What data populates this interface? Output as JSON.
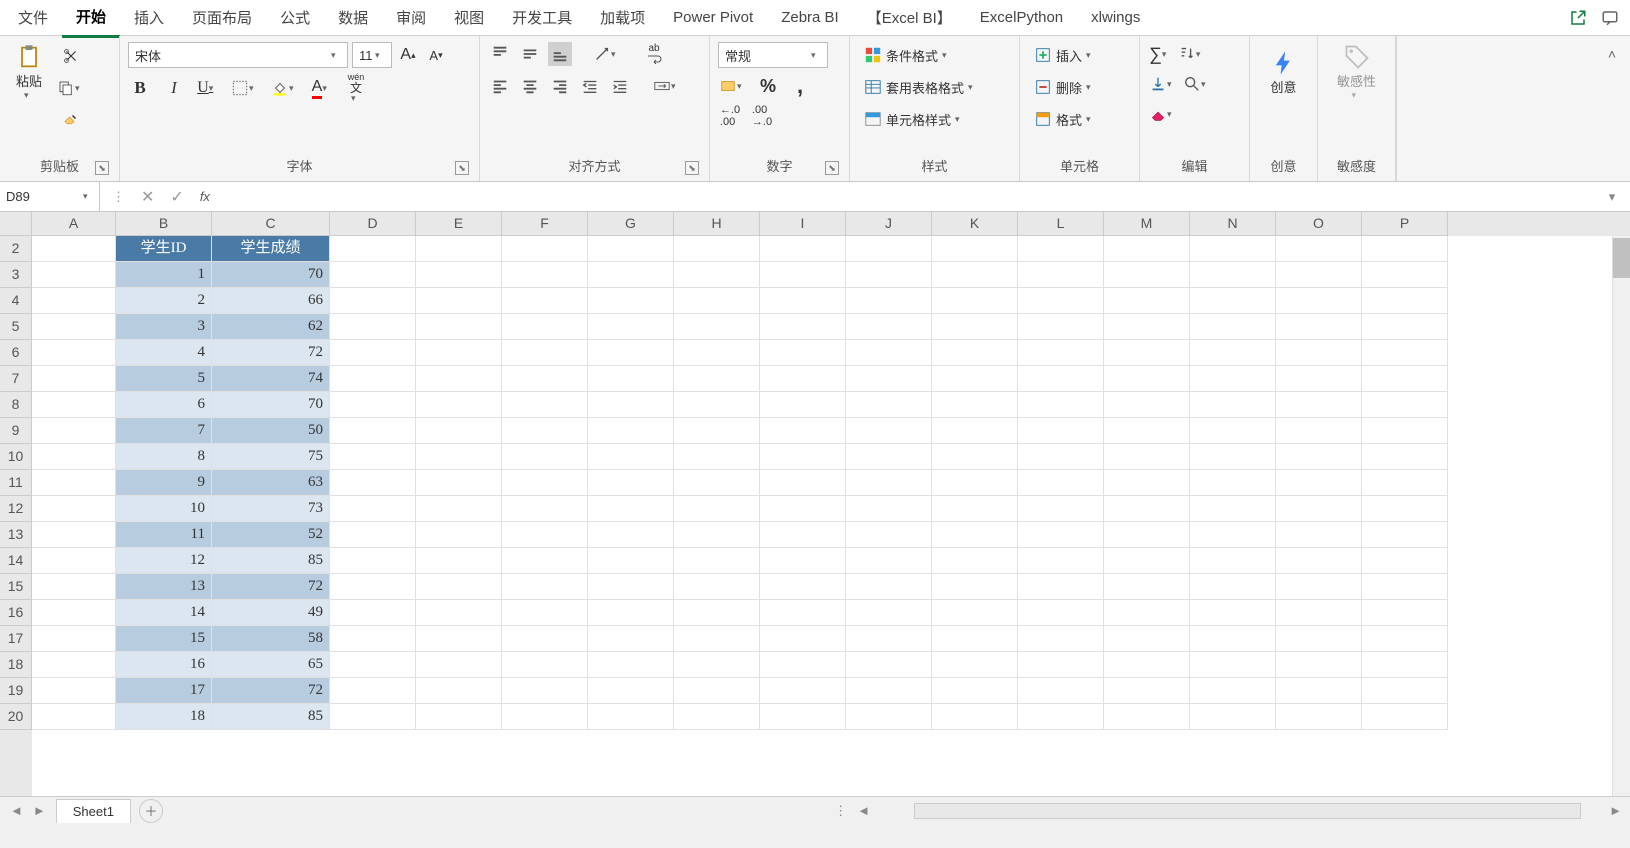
{
  "tabs": {
    "file": "文件",
    "home": "开始",
    "insert": "插入",
    "layout": "页面布局",
    "formula": "公式",
    "data": "数据",
    "review": "审阅",
    "view": "视图",
    "dev": "开发工具",
    "addin": "加载项",
    "pp": "Power Pivot",
    "zb": "Zebra BI",
    "eb": "【Excel BI】",
    "ep": "ExcelPython",
    "xw": "xlwings"
  },
  "ribbon": {
    "clipboard": {
      "paste": "粘贴",
      "label": "剪贴板"
    },
    "font": {
      "name": "宋体",
      "size": "11",
      "wenzi": "wén",
      "wenzi2": "文",
      "label": "字体"
    },
    "align": {
      "ab": "ab",
      "label": "对齐方式"
    },
    "number": {
      "format": "常规",
      "label": "数字"
    },
    "styles": {
      "cond": "条件格式",
      "table": "套用表格格式",
      "cell": "单元格样式",
      "label": "样式"
    },
    "cells": {
      "insert": "插入",
      "delete": "删除",
      "format": "格式",
      "label": "单元格"
    },
    "editing": {
      "label": "编辑"
    },
    "idea": {
      "btn": "创意",
      "label": "创意"
    },
    "sens": {
      "btn": "敏感性",
      "label": "敏感度"
    }
  },
  "formula_bar": {
    "name_box": "D89",
    "fx": "fx"
  },
  "columns": [
    "A",
    "B",
    "C",
    "D",
    "E",
    "F",
    "G",
    "H",
    "I",
    "J",
    "K",
    "L",
    "M",
    "N",
    "O",
    "P"
  ],
  "row_start": 2,
  "table": {
    "headers": [
      "学生ID",
      "学生成绩"
    ],
    "rows": [
      [
        1,
        70
      ],
      [
        2,
        66
      ],
      [
        3,
        62
      ],
      [
        4,
        72
      ],
      [
        5,
        74
      ],
      [
        6,
        70
      ],
      [
        7,
        50
      ],
      [
        8,
        75
      ],
      [
        9,
        63
      ],
      [
        10,
        73
      ],
      [
        11,
        52
      ],
      [
        12,
        85
      ],
      [
        13,
        72
      ],
      [
        14,
        49
      ],
      [
        15,
        58
      ],
      [
        16,
        65
      ],
      [
        17,
        72
      ],
      [
        18,
        85
      ]
    ]
  },
  "sheet": {
    "name": "Sheet1"
  }
}
